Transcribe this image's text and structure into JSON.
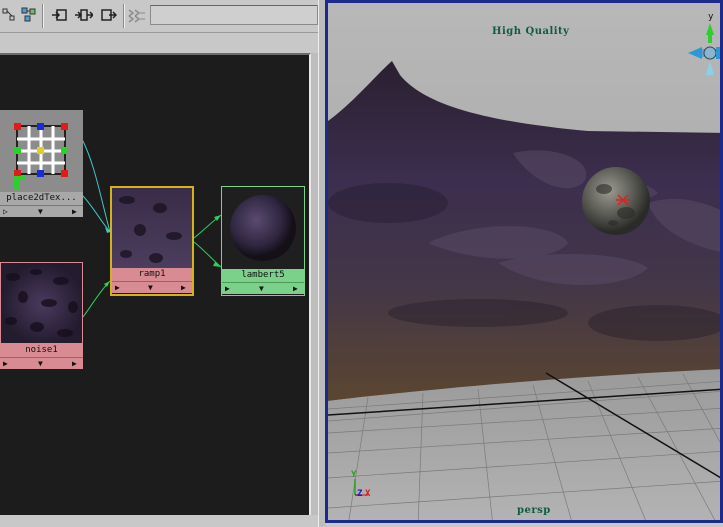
{
  "toolbar": {
    "buttons": [
      {
        "name": "graph-layout-icon"
      },
      {
        "name": "clear-graph-icon"
      },
      {
        "name": "graph-input-icon"
      },
      {
        "name": "graph-input-output-icon"
      },
      {
        "name": "graph-output-icon"
      },
      {
        "name": "graph-disabled-icon"
      }
    ]
  },
  "nodes": {
    "place2d": {
      "label": "place2dTex..."
    },
    "noise": {
      "label": "noise1"
    },
    "ramp": {
      "label": "ramp1"
    },
    "lambert": {
      "label": "lambert5"
    }
  },
  "viewport": {
    "quality_label": "High Quality",
    "camera_label": "persp",
    "axis_y": "Y",
    "axis_z": "Z",
    "axis_x": "X"
  },
  "colors": {
    "graph_bg": "#1c1c1c",
    "selected_node": "#d4b21a",
    "texture_label": "#d98b93",
    "shader_label": "#7bd18a",
    "connection_cyan": "#3fc8c8",
    "connection_green": "#2ecf5a",
    "viewport_border": "#1d2a8c",
    "camera_label": "#0f5c3c"
  }
}
